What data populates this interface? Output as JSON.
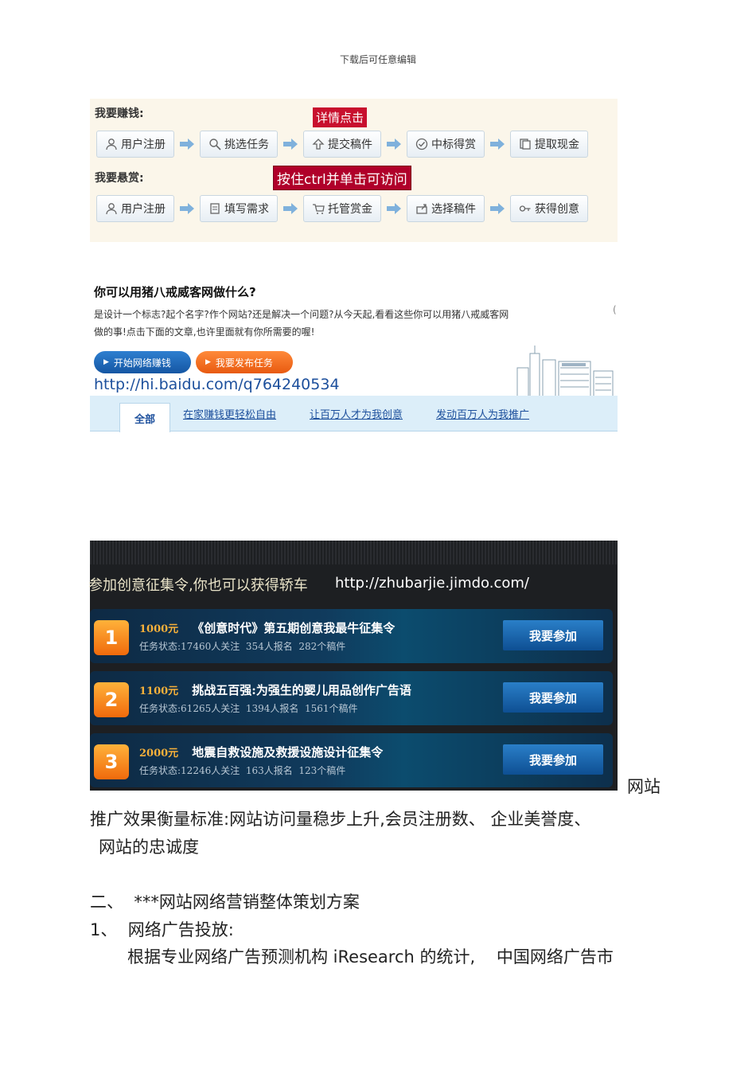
{
  "header_note": "下载后可任意编辑",
  "panel_earn": {
    "earn_label": "我要赚钱:",
    "detail_tag": "详情点击",
    "earn_steps": [
      "用户注册",
      "挑选任务",
      "提交稿件",
      "中标得赏",
      "提取现金"
    ],
    "reward_label": "我要悬赏:",
    "ctrl_tag": "按住ctrl并单击可访问",
    "reward_steps": [
      "用户注册",
      "填写需求",
      "托管赏金",
      "选择稿件",
      "获得创意"
    ]
  },
  "panel_intro": {
    "title": "你可以用猪八戒威客网做什么?",
    "desc_line1": "是设计一个标志?起个名字?作个网站?还是解决一个问题?从今天起,看看这些你可以用猪八戒威客网",
    "desc_line2": "做的事!点击下面的文章,也许里面就有你所需要的喔!",
    "btn_start": "开始网络赚钱",
    "btn_publish": "我要发布任务",
    "url": "http://hi.baidu.com/q764240534",
    "tab_all": "全部",
    "tab_links": [
      "在家赚钱更轻松自由",
      "让百万人才为我创意",
      "发动百万人为我推广"
    ]
  },
  "panel_tasks": {
    "banner_text": "参加创意征集令,你也可以获得轿车",
    "banner_url": "http://zhubarjie.jimdo.com/",
    "tasks": [
      {
        "num": "1",
        "price": "1000元",
        "title": "《创意时代》第五期创意我最牛征集令",
        "status": "任务状态:17460人关注  354人报名  282个稿件",
        "button": "我要参加"
      },
      {
        "num": "2",
        "price": "1100元",
        "title": "挑战五百强:为强生的婴儿用品创作广告语",
        "status": "任务状态:61265人关注  1394人报名  1561个稿件",
        "button": "我要参加"
      },
      {
        "num": "3",
        "price": "2000元",
        "title": "地震自救设施及救援设施设计征集令",
        "status": "任务状态:12246人关注  163人报名  123个稿件",
        "button": "我要参加"
      }
    ]
  },
  "body": {
    "line1_tail": "网站",
    "line2": "推广效果衡量标准:网站访问量稳步上升,会员注册数、 企业美誉度、",
    "line3": "网站的忠诚度",
    "section2": "二、  ***网站网络营销整体策划方案",
    "item1": "1、  网络广告投放:",
    "item1_text": "根据专业网络广告预测机构 iResearch 的统计,    中国网络广告市"
  },
  "colors": {
    "accent_blue": "#1c4f9c",
    "red_tag": "#c8102e",
    "orange": "#f06a0c",
    "dark_bg": "#1d1f22"
  }
}
